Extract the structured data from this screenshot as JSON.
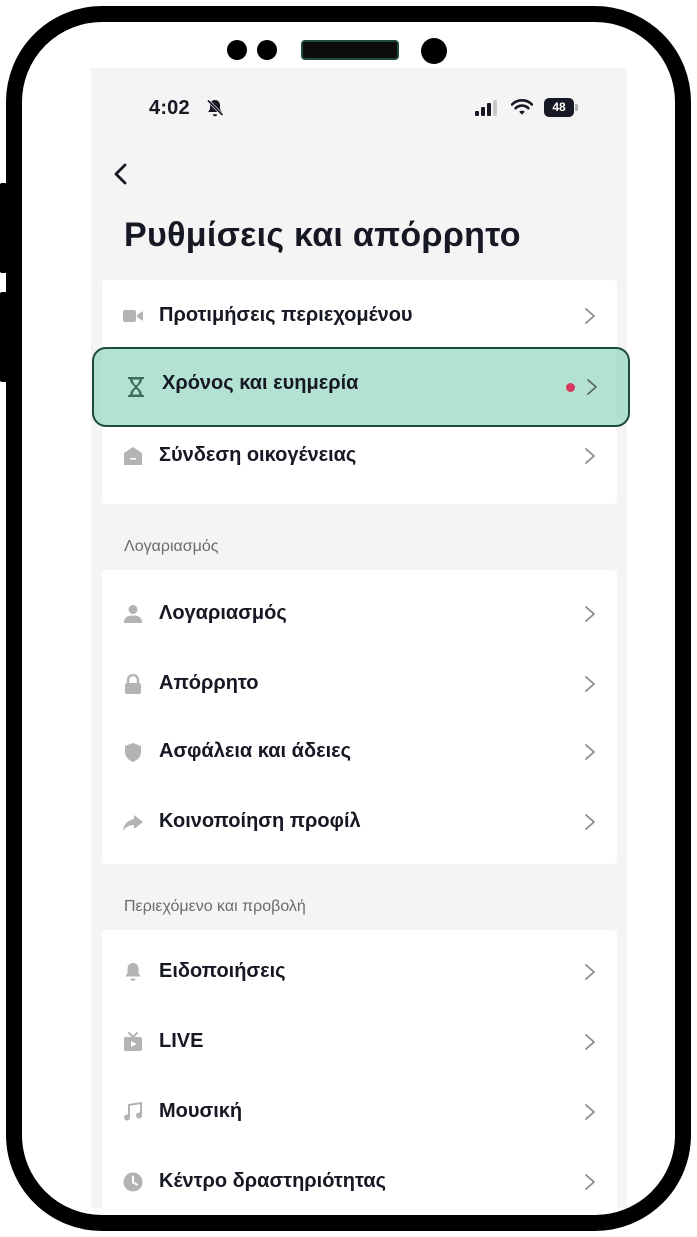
{
  "status_bar": {
    "time": "4:02",
    "battery": "48"
  },
  "header": {
    "title": "Ρυθμίσεις και απόρρητο"
  },
  "groups": [
    {
      "label": "",
      "items": [
        {
          "label": "Προτιμήσεις περιεχομένου",
          "icon": "video-icon"
        },
        {
          "label": "Χρόνος και ευημερία",
          "icon": "hourglass-icon",
          "highlighted": true,
          "has_notification_dot": true
        },
        {
          "label": "Σύνδεση οικογένειας",
          "icon": "home-icon"
        }
      ]
    },
    {
      "label": "Λογαριασμός",
      "items": [
        {
          "label": "Λογαριασμός",
          "icon": "person-icon"
        },
        {
          "label": "Απόρρητο",
          "icon": "lock-icon"
        },
        {
          "label": "Ασφάλεια και άδειες",
          "icon": "shield-icon"
        },
        {
          "label": "Κοινοποίηση προφίλ",
          "icon": "share-icon"
        }
      ]
    },
    {
      "label": "Περιεχόμενο και προβολή",
      "items": [
        {
          "label": "Ειδοποιήσεις",
          "icon": "bell-icon"
        },
        {
          "label": "LIVE",
          "icon": "tv-icon"
        },
        {
          "label": "Μουσική",
          "icon": "music-note-icon"
        },
        {
          "label": "Κέντρο δραστηριότητας",
          "icon": "clock-icon"
        }
      ]
    }
  ],
  "colors": {
    "highlight_fill": "#96d6c0",
    "highlight_border": "#1c4a3c",
    "notification_dot": "#d5385c",
    "screen_bg": "#f4f4f4",
    "icon_gray": "#b3b3b6"
  }
}
